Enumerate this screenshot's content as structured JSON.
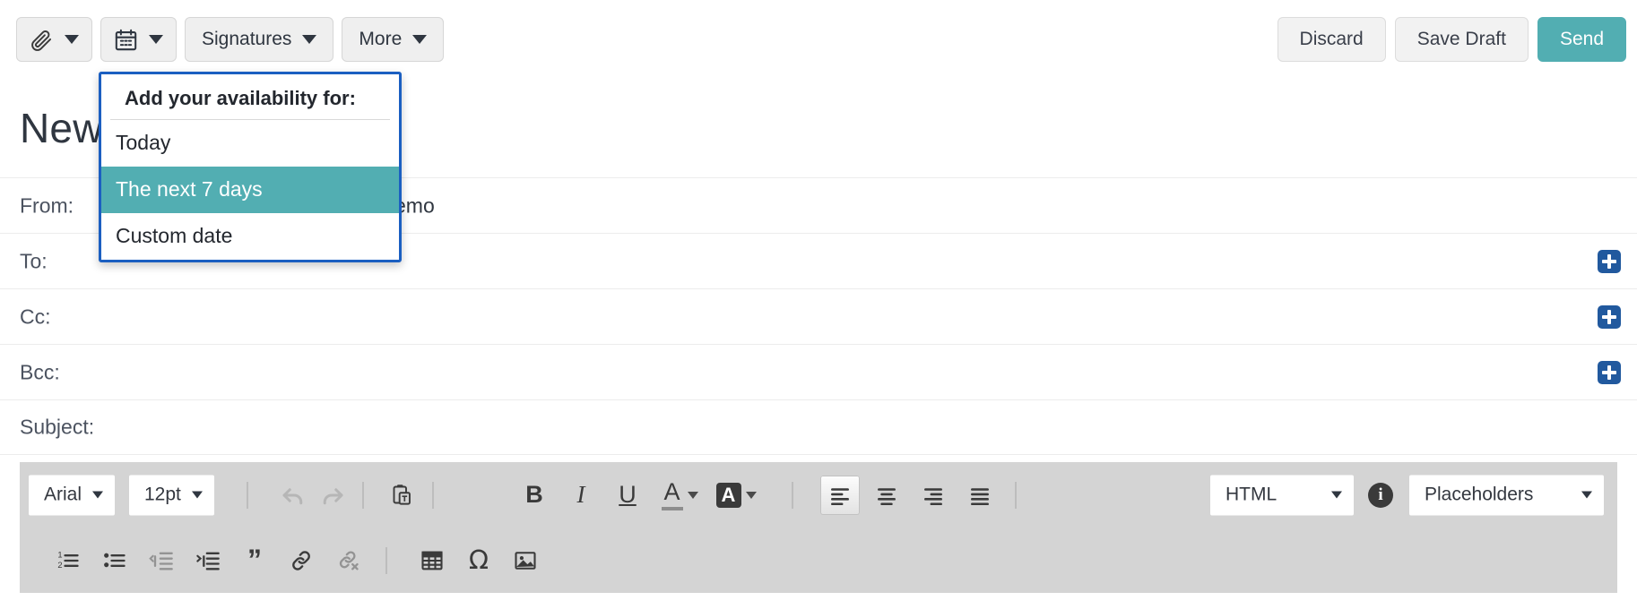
{
  "toolbar": {
    "attach_icon": "paperclip-icon",
    "attach_label": "",
    "calendar_icon": "calendar-icon",
    "signatures_label": "Signatures",
    "more_label": "More",
    "discard_label": "Discard",
    "save_draft_label": "Save Draft",
    "send_label": "Send"
  },
  "availability_menu": {
    "header": "Add your availability for:",
    "items": [
      {
        "label": "Today",
        "selected": false
      },
      {
        "label": "The next 7 days",
        "selected": true
      },
      {
        "label": "Custom date",
        "selected": false
      }
    ],
    "border_color": "#1b5fc1",
    "highlight_color": "#52aeb2"
  },
  "compose": {
    "title": "New",
    "fields": [
      {
        "label": "From:",
        "value": "emo",
        "has_add": false
      },
      {
        "label": "To:",
        "value": "",
        "has_add": true
      },
      {
        "label": "Cc:",
        "value": "",
        "has_add": true
      },
      {
        "label": "Bcc:",
        "value": "",
        "has_add": true
      },
      {
        "label": "Subject:",
        "value": "",
        "has_add": false
      }
    ],
    "add_button_icon": "plus-icon",
    "add_button_color": "#21599e"
  },
  "editor_toolbar": {
    "font_family": "Arial",
    "font_size": "12pt",
    "mode": "HTML",
    "placeholders_label": "Placeholders",
    "info_label": "i",
    "row1_tools": [
      {
        "name": "undo-icon",
        "disabled": true
      },
      {
        "name": "redo-icon",
        "disabled": true
      },
      {
        "name": "paste-as-text-icon",
        "disabled": false
      },
      {
        "name": "bold-icon",
        "glyph": "B",
        "disabled": false
      },
      {
        "name": "italic-icon",
        "glyph": "I",
        "disabled": false
      },
      {
        "name": "underline-icon",
        "glyph": "U",
        "disabled": false
      },
      {
        "name": "text-color-icon",
        "glyph": "A",
        "disabled": false
      },
      {
        "name": "background-color-icon",
        "glyph": "A",
        "disabled": false
      },
      {
        "name": "align-left-icon",
        "active": true
      },
      {
        "name": "align-center-icon",
        "active": false
      },
      {
        "name": "align-right-icon",
        "active": false
      },
      {
        "name": "align-justify-icon",
        "active": false
      }
    ],
    "row2_tools": [
      {
        "name": "numbered-list-icon",
        "disabled": false
      },
      {
        "name": "bulleted-list-icon",
        "disabled": false
      },
      {
        "name": "decrease-indent-icon",
        "disabled": true
      },
      {
        "name": "increase-indent-icon",
        "disabled": false
      },
      {
        "name": "blockquote-icon",
        "disabled": false
      },
      {
        "name": "insert-link-icon",
        "disabled": false
      },
      {
        "name": "remove-link-icon",
        "disabled": true
      },
      {
        "name": "insert-table-icon",
        "disabled": false
      },
      {
        "name": "special-character-icon",
        "disabled": false
      },
      {
        "name": "insert-image-icon",
        "disabled": false
      }
    ]
  }
}
